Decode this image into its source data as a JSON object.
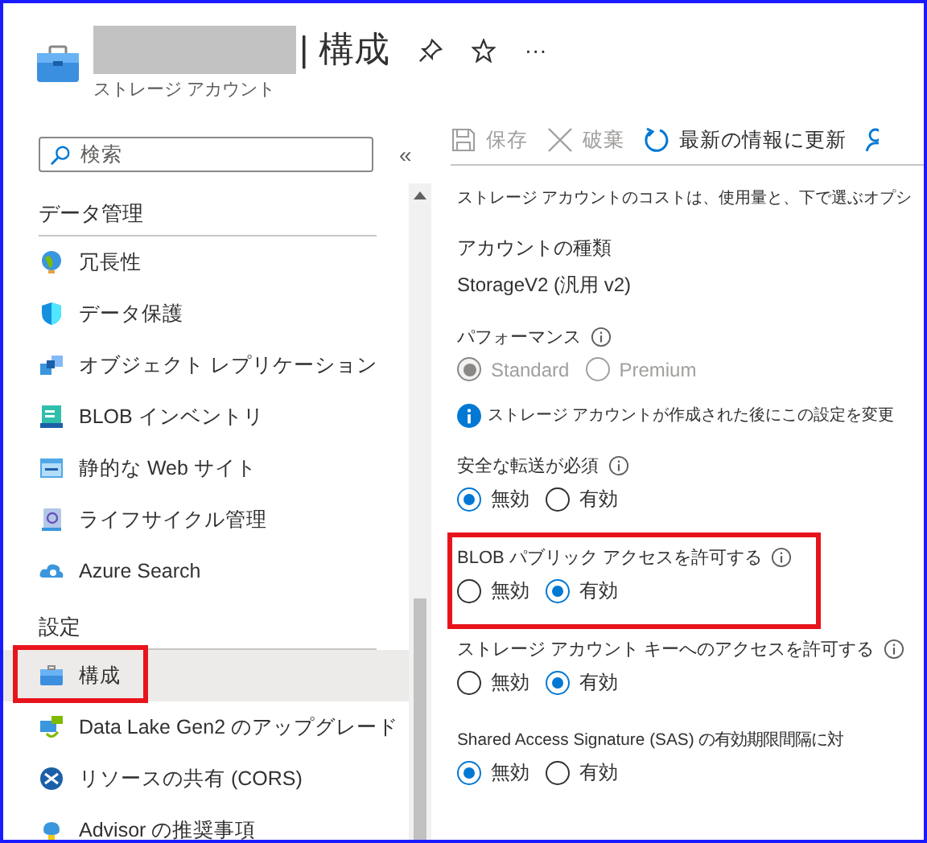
{
  "header": {
    "title": "| 構成",
    "subtitle": "ストレージ アカウント",
    "more": "···"
  },
  "sidebar": {
    "search": {
      "placeholder": "検索"
    },
    "collapse": "«",
    "sections": [
      {
        "heading": "データ管理",
        "items": [
          {
            "label": "冗長性",
            "selected": false,
            "highlighted": false
          },
          {
            "label": "データ保護",
            "selected": false,
            "highlighted": false
          },
          {
            "label": "オブジェクト レプリケーション",
            "selected": false,
            "highlighted": false
          },
          {
            "label": "BLOB インベントリ",
            "selected": false,
            "highlighted": false
          },
          {
            "label": "静的な Web サイト",
            "selected": false,
            "highlighted": false
          },
          {
            "label": "ライフサイクル管理",
            "selected": false,
            "highlighted": false
          },
          {
            "label": "Azure Search",
            "selected": false,
            "highlighted": false
          }
        ]
      },
      {
        "heading": "設定",
        "items": [
          {
            "label": "構成",
            "selected": true,
            "highlighted": true
          },
          {
            "label": "Data Lake Gen2 のアップグレード",
            "selected": false,
            "highlighted": false
          },
          {
            "label": "リソースの共有 (CORS)",
            "selected": false,
            "highlighted": false
          },
          {
            "label": "Advisor の推奨事項",
            "selected": false,
            "highlighted": false
          }
        ]
      }
    ]
  },
  "toolbar": [
    {
      "label": "保存",
      "disabled": true
    },
    {
      "label": "破棄",
      "disabled": true
    },
    {
      "label": "最新の情報に更新",
      "disabled": false
    }
  ],
  "content": [
    {
      "kind": "text",
      "text": "ストレージ アカウントのコストは、使用量と、下で選ぶオプシ"
    },
    {
      "kind": "value",
      "label": "アカウントの種類",
      "value": "StorageV2 (汎用 v2)"
    },
    {
      "kind": "radio",
      "label": "パフォーマンス",
      "info": true,
      "disabled": true,
      "highlighted": false,
      "options": [
        {
          "label": "Standard",
          "selected": true
        },
        {
          "label": "Premium",
          "selected": false
        }
      ]
    },
    {
      "kind": "notice",
      "text": "ストレージ アカウントが作成された後にこの設定を変更"
    },
    {
      "kind": "radio",
      "label": "安全な転送が必須",
      "info": true,
      "disabled": false,
      "highlighted": false,
      "options": [
        {
          "label": "無効",
          "selected": true
        },
        {
          "label": "有効",
          "selected": false
        }
      ]
    },
    {
      "kind": "radio",
      "label": "BLOB パブリック アクセスを許可する",
      "info": true,
      "disabled": false,
      "highlighted": true,
      "options": [
        {
          "label": "無効",
          "selected": false
        },
        {
          "label": "有効",
          "selected": true
        }
      ]
    },
    {
      "kind": "radio",
      "label": "ストレージ アカウント キーへのアクセスを許可する",
      "info": true,
      "disabled": false,
      "highlighted": false,
      "options": [
        {
          "label": "無効",
          "selected": false
        },
        {
          "label": "有効",
          "selected": true
        }
      ]
    },
    {
      "kind": "radio",
      "label": "Shared Access Signature (SAS) の有効期限間隔に対",
      "info": false,
      "disabled": false,
      "highlighted": false,
      "options": [
        {
          "label": "無効",
          "selected": true
        },
        {
          "label": "有効",
          "selected": false
        }
      ]
    }
  ]
}
